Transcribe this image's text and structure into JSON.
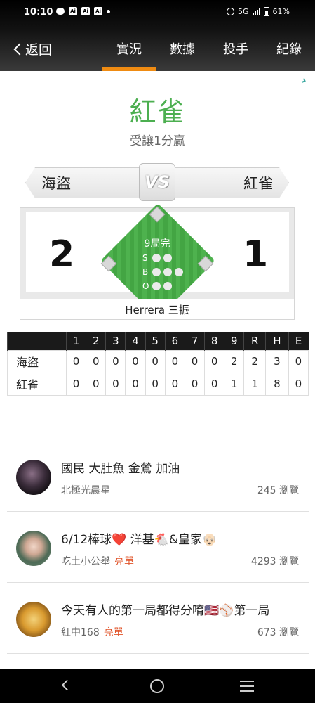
{
  "status": {
    "time": "10:10",
    "network": "5G",
    "battery": "61%"
  },
  "nav": {
    "back_label": "返回",
    "tabs": [
      "實況",
      "數據",
      "投手",
      "紀錄"
    ],
    "active_tab": "實況"
  },
  "game": {
    "result_title": "紅雀",
    "result_subtitle": "受讓1分贏",
    "away_team": "海盜",
    "home_team": "紅雀",
    "vs_label": "VS",
    "away_score": "2",
    "home_score": "1",
    "inning_label": "9局完",
    "count_labels": [
      "S",
      "B",
      "O"
    ],
    "last_play": "Herrera 三振"
  },
  "linescore": {
    "headers": [
      "",
      "1",
      "2",
      "3",
      "4",
      "5",
      "6",
      "7",
      "8",
      "9",
      "R",
      "H",
      "E"
    ],
    "rows": [
      {
        "team": "海盜",
        "values": [
          "0",
          "0",
          "0",
          "0",
          "0",
          "0",
          "0",
          "0",
          "2",
          "2",
          "3",
          "0"
        ]
      },
      {
        "team": "紅雀",
        "values": [
          "0",
          "0",
          "0",
          "0",
          "0",
          "0",
          "0",
          "0",
          "1",
          "1",
          "8",
          "0"
        ]
      }
    ]
  },
  "posts": [
    {
      "title": "國民 大肚魚 金鶯 加油",
      "author": "北極光晨星",
      "tag": "",
      "views": "245 瀏覽"
    },
    {
      "title": "6/12棒球❤️ 洋基🐔&皇家👴🏻",
      "author": "吃土小公舉",
      "tag": "亮單",
      "views": "4293 瀏覽"
    },
    {
      "title": "今天有人的第一局都得分唷🇺🇸⚾第一局",
      "author": "紅中168",
      "tag": "亮單",
      "views": "673 瀏覽"
    }
  ],
  "colors": {
    "accent": "#ef8b12",
    "result_green": "#4caf50",
    "tag_red": "#e0542a"
  }
}
